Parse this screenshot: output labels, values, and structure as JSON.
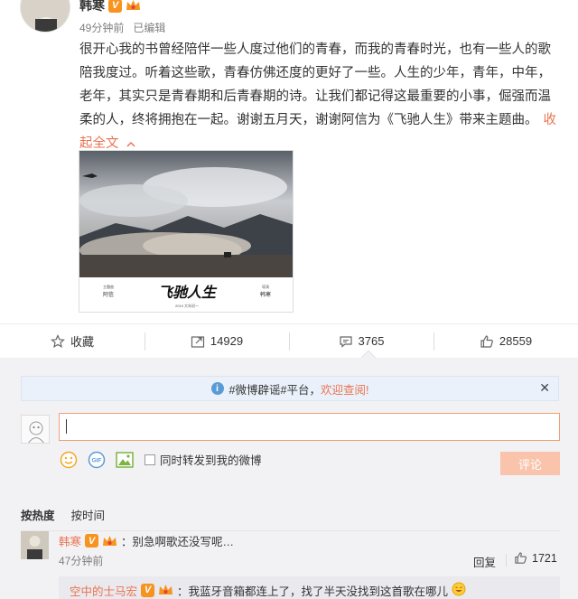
{
  "post": {
    "author": "韩寒",
    "time": "49分钟前",
    "edited": "已编辑",
    "text": "很开心我的书曾经陪伴一些人度过他们的青春，而我的青春时光，也有一些人的歌陪我度过。听着这些歌，青春仿佛还度的更好了一些。人生的少年，青年，中年，老年，其实只是青春期和后青春期的诗。让我们都记得这最重要的小事，倔强而温柔的人，终将拥抱在一起。谢谢五月天，谢谢阿信为《飞驰人生》带来主题曲。",
    "collapse_label": "收起全文",
    "poster": {
      "credit_left_small": "主題曲",
      "credit_left": "阿信",
      "title": "飞驰人生",
      "date": "2019 大年初一",
      "credit_right_small": "導演",
      "credit_right": "韩寒"
    }
  },
  "actions": {
    "favorite": "收藏",
    "repost": "14929",
    "comment": "3765",
    "like": "28559"
  },
  "notice": {
    "prefix": "#微博辟谣#平台，",
    "highlight": "欢迎查阅!"
  },
  "composer": {
    "forward_label": "同时转发到我的微博",
    "submit_label": "评论"
  },
  "sort": {
    "hot": "按热度",
    "time": "按时间"
  },
  "comments": [
    {
      "user": "韩寒",
      "text": "：别急啊歌还没写呢…",
      "time": "47分钟前",
      "reply": "回复",
      "likes": "1721"
    }
  ],
  "sub_reply": {
    "user": "空中的士马宏",
    "text": "：我蓝牙音箱都连上了，找了半天没找到这首歌在哪儿"
  },
  "colors": {
    "accent": "#eb7350",
    "vip": "#f7931e",
    "link_blue": "#5b9bd5"
  },
  "icons": [
    "star-icon",
    "repost-icon",
    "comment-icon",
    "thumbs-up-icon",
    "info-icon",
    "close-icon",
    "emoji-icon",
    "gif-icon",
    "image-icon",
    "verified-v-icon",
    "vip-crown-icon",
    "smile-emoji-icon"
  ]
}
